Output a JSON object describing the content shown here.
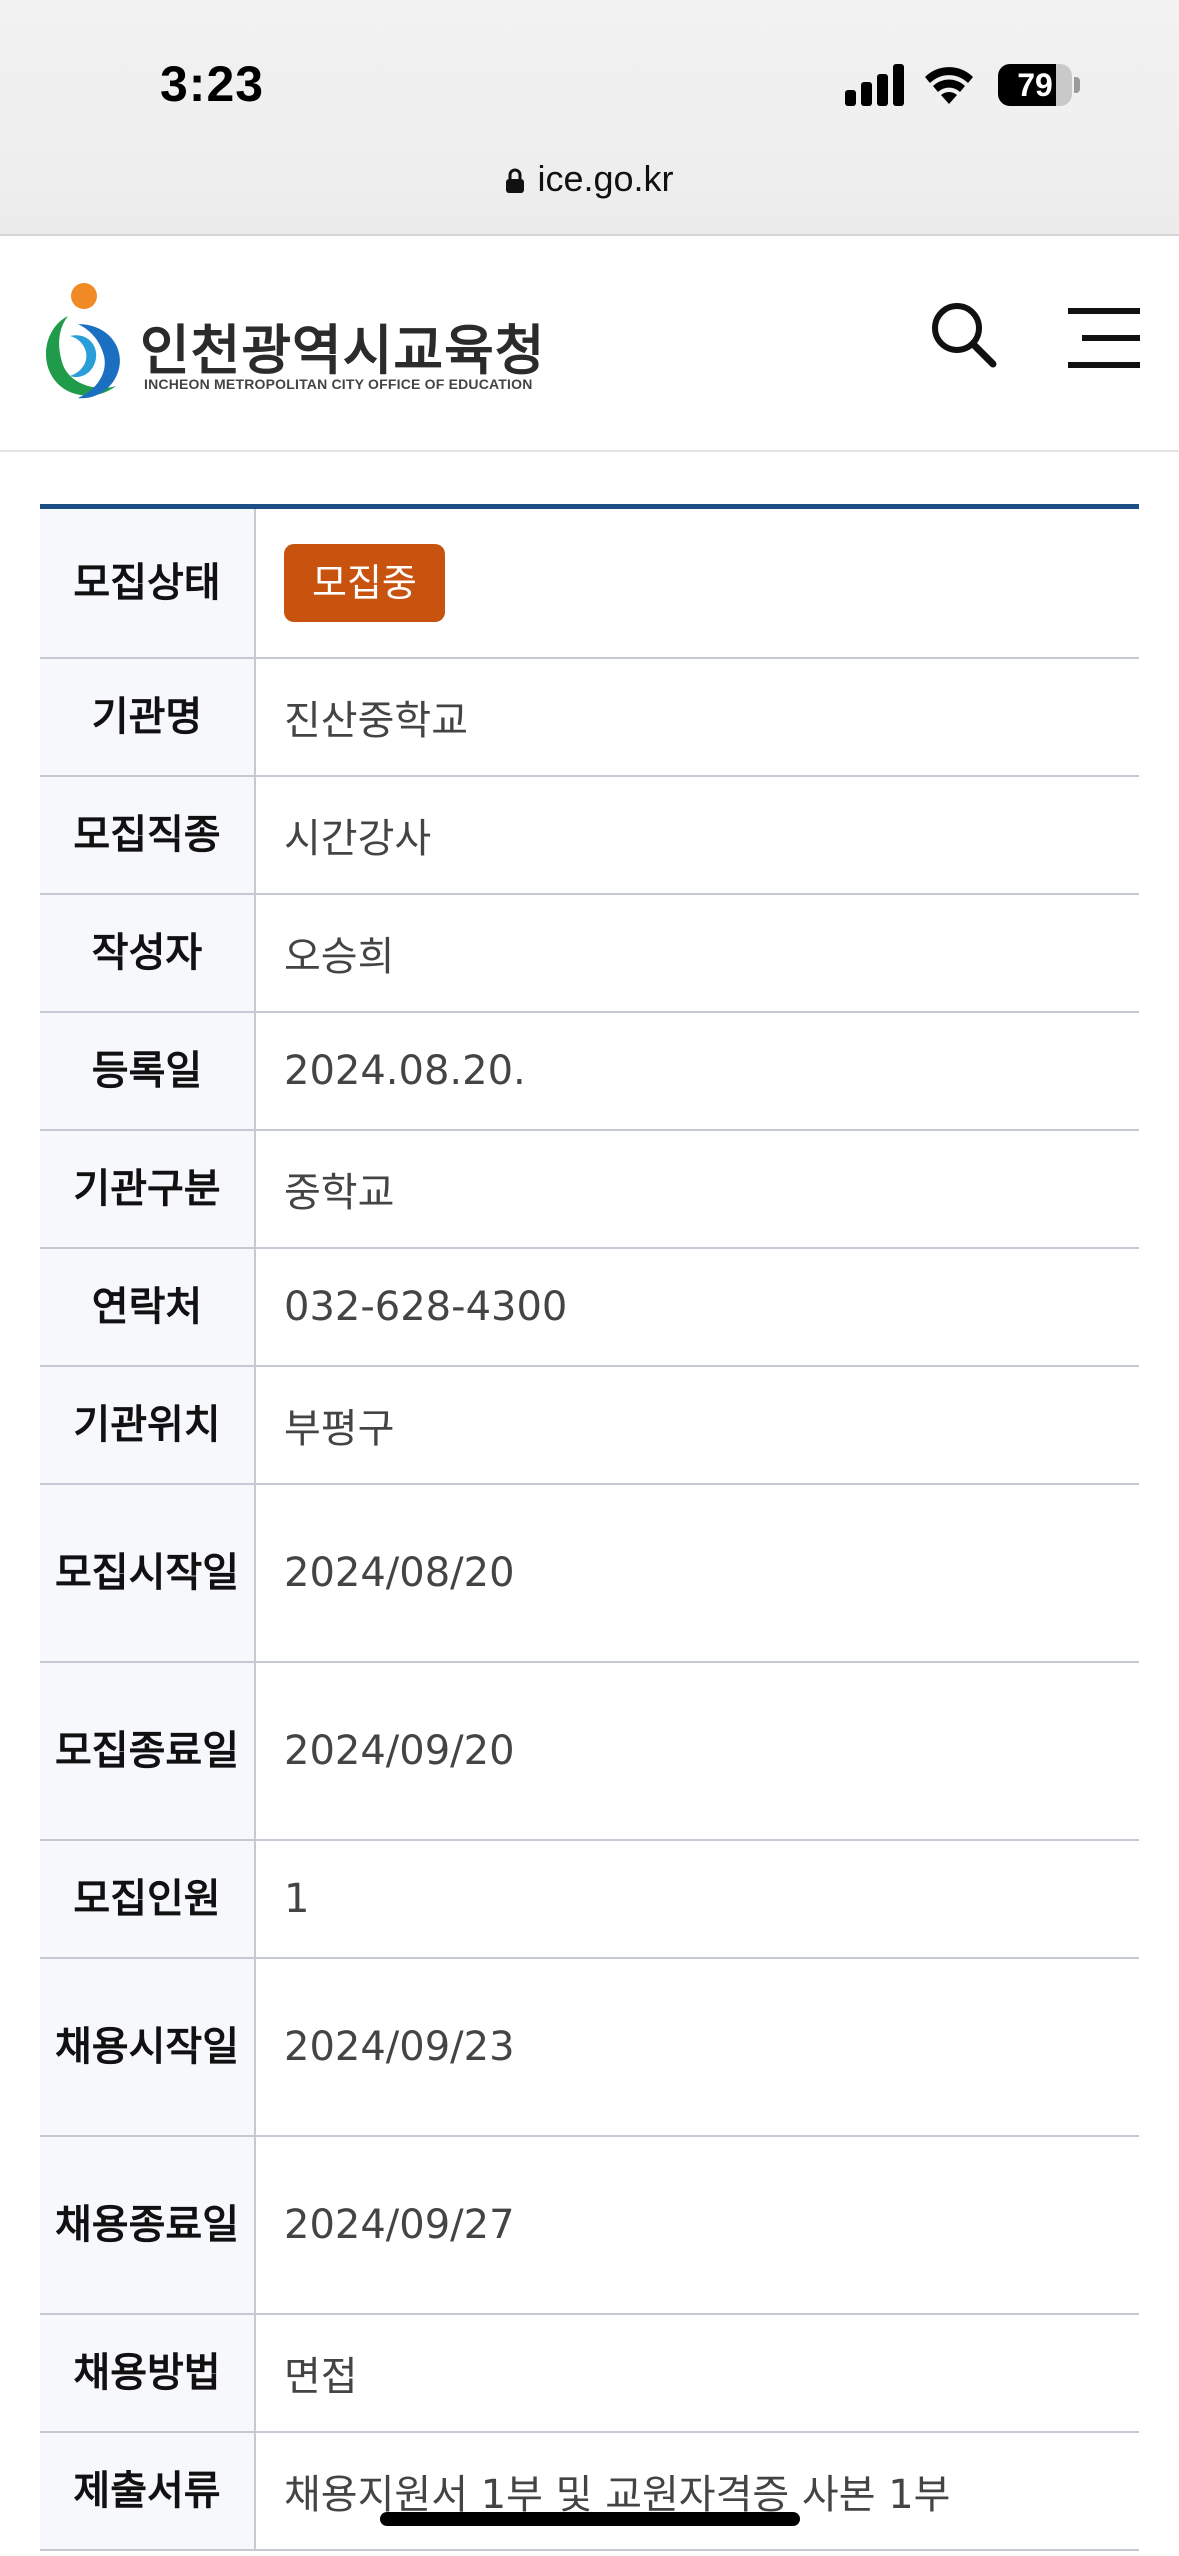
{
  "status_bar": {
    "time": "3:23",
    "battery": "79",
    "battery_level": 0.79
  },
  "browser": {
    "url": "ice.go.kr"
  },
  "site": {
    "name_ko": "인천광역시교육청",
    "name_en": "INCHEON METROPOLITAN CITY OFFICE OF EDUCATION",
    "icons": [
      "logo-icon",
      "search-icon",
      "hamburger-menu-icon"
    ]
  },
  "colors": {
    "accent": "#1b4f86",
    "badge": "#c8530e"
  },
  "details": [
    {
      "label": "모집상태",
      "value": "모집중",
      "type": "badge"
    },
    {
      "label": "기관명",
      "value": "진산중학교"
    },
    {
      "label": "모집직종",
      "value": "시간강사"
    },
    {
      "label": "작성자",
      "value": "오승희"
    },
    {
      "label": "등록일",
      "value": "2024.08.20."
    },
    {
      "label": "기관구분",
      "value": "중학교"
    },
    {
      "label": "연락처",
      "value": "032-628-4300"
    },
    {
      "label": "기관위치",
      "value": "부평구"
    },
    {
      "label": "모집시작일",
      "value": "2024/08/20"
    },
    {
      "label": "모집종료일",
      "value": "2024/09/20"
    },
    {
      "label": "모집인원",
      "value": "1"
    },
    {
      "label": "채용시작일",
      "value": "2024/09/23"
    },
    {
      "label": "채용종료일",
      "value": "2024/09/27"
    },
    {
      "label": "채용방법",
      "value": "면접"
    },
    {
      "label": "제출서류",
      "value": "채용지원서 1부 및 교원자격증 사본 1부"
    }
  ]
}
